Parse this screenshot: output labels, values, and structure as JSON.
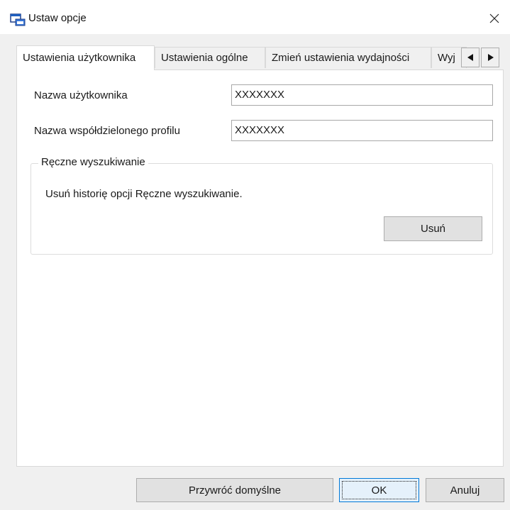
{
  "window": {
    "title": "Ustaw opcje",
    "icon": "app-window-icon",
    "close_icon": "close-icon"
  },
  "tabs": [
    {
      "label": "Ustawienia użytkownika",
      "active": true
    },
    {
      "label": "Ustawienia ogólne",
      "active": false
    },
    {
      "label": "Zmień ustawienia wydajności",
      "active": false
    },
    {
      "label": "Wyj",
      "active": false
    }
  ],
  "tab_scroll": {
    "left_icon": "arrow-left-icon",
    "right_icon": "arrow-right-icon"
  },
  "user_settings": {
    "username_label": "Nazwa użytkownika",
    "username_value": "XXXXXXX",
    "shared_profile_label": "Nazwa współdzielonego profilu",
    "shared_profile_value": "XXXXXXX"
  },
  "manual_search": {
    "legend": "Ręczne wyszukiwanie",
    "description": "Usuń historię opcji Ręczne wyszukiwanie.",
    "delete_label": "Usuń"
  },
  "footer": {
    "restore_label": "Przywróć domyślne",
    "ok_label": "OK",
    "cancel_label": "Anuluj"
  },
  "colors": {
    "dialog_bg": "#f0f0f0",
    "page_bg": "#ffffff",
    "button_bg": "#e1e1e1",
    "default_button_border": "#0078d7"
  }
}
